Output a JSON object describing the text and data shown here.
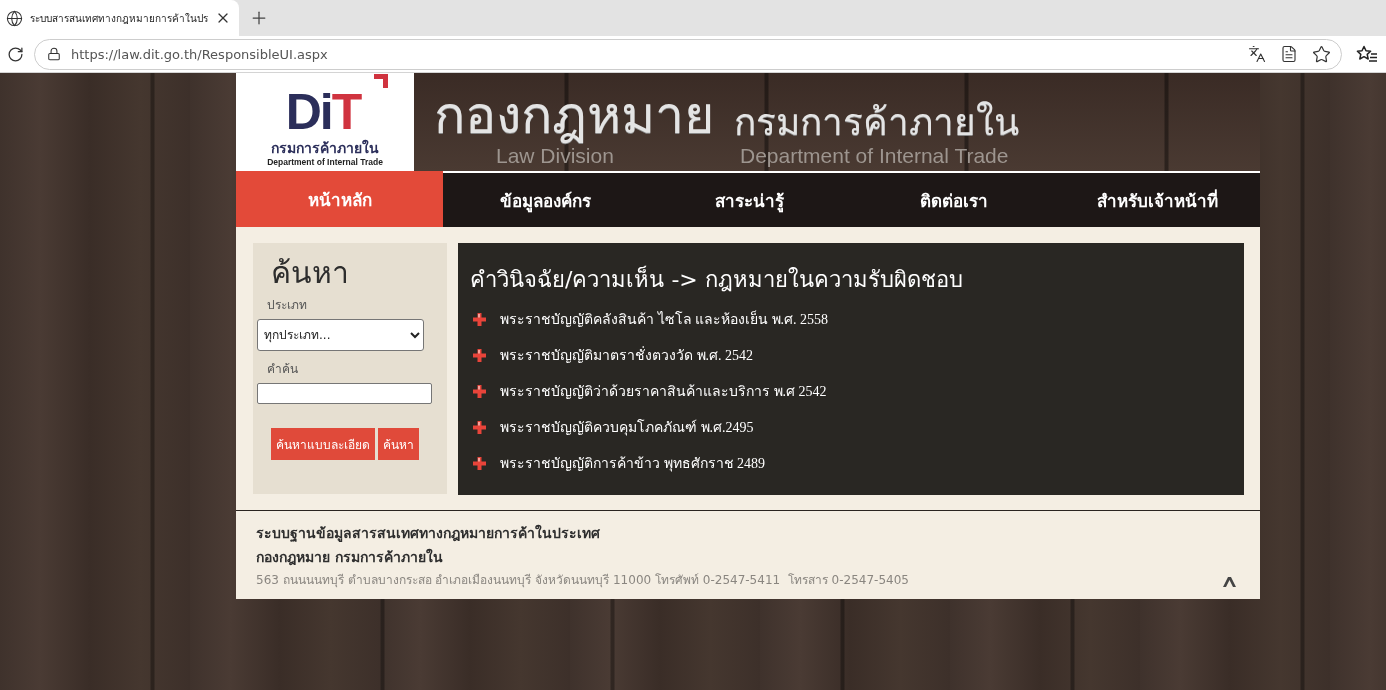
{
  "browser": {
    "tabs": [
      {
        "title": "ระบบสารสนเทศทางกฎหมายการค้าในปร",
        "selected": true
      }
    ],
    "address": "https://law.dit.go.th/ResponsibleUI.aspx"
  },
  "header": {
    "logo": {
      "mark": "DiT",
      "name_th": "กรมการค้าภายใน",
      "name_en": "Department of Internal Trade"
    },
    "title": "กองกฎหมาย",
    "title_sub": "Law Division",
    "department": "กรมการค้าภายใน",
    "department_sub": "Department of Internal Trade"
  },
  "nav": [
    {
      "label": "หน้าหลัก",
      "selected": true
    },
    {
      "label": "ข้อมูลองค์กร",
      "selected": false
    },
    {
      "label": "สาระน่ารู้",
      "selected": false
    },
    {
      "label": "ติดต่อเรา",
      "selected": false
    },
    {
      "label": "สำหรับเจ้าหน้าที่",
      "selected": false
    }
  ],
  "search": {
    "title": "ค้นหา",
    "type_label": "ประเภท",
    "type_value": "ทุกประเภท...",
    "keyword_label": "คำค้น",
    "buttons": [
      "ค้นหาแบบละเอียด",
      "ค้นหา"
    ]
  },
  "laws": {
    "heading": "คำวินิจฉัย/ความเห็น -> กฎหมายในความรับผิดชอบ",
    "items": [
      "พระราชบัญญัติคลังสินค้า ไซโล และห้องเย็น พ.ศ. 2558",
      "พระราชบัญญัติมาตราชั่งตวงวัด พ.ศ. 2542",
      "พระราชบัญญัติว่าด้วยราคาสินค้าและบริการ พ.ศ 2542",
      "พระราชบัญญัติควบคุมโภคภัณฑ์ พ.ศ.2495",
      "พระราชบัญญัติการค้าข้าว พุทธศักราช 2489"
    ]
  },
  "footer": {
    "system": "ระบบฐานข้อมูลสารสนเทศทางกฎหมายการค้าในประเทศ",
    "office": "กองกฎหมาย กรมการค้าภายใน",
    "address": "563 ถนนนนทบุรี ตำบลบางกระสอ อำเภอเมืองนนทบุรี จังหวัดนนทบุรี 11000 โทรศัพท์ 0-2547-5411  โทรสาร 0-2547-5405"
  }
}
